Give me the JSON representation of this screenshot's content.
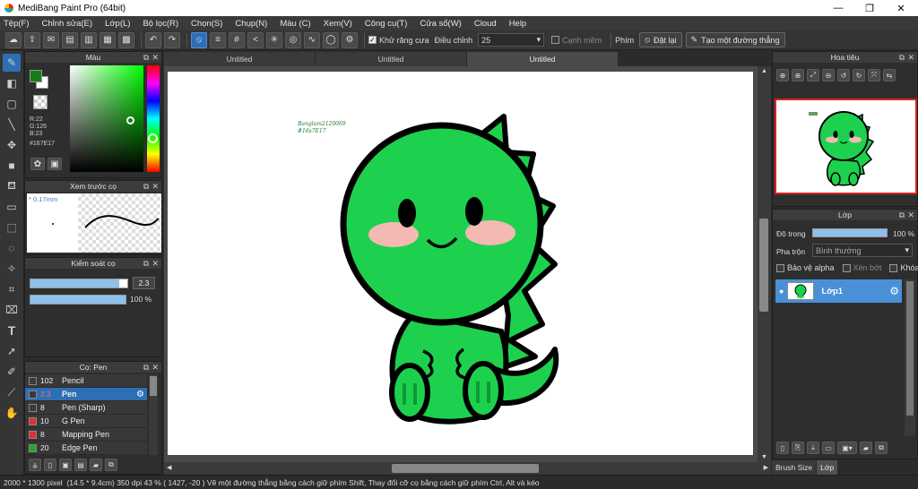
{
  "window": {
    "title": "MediBang Paint Pro (64bit)",
    "minimize": "—",
    "maximize": "❐",
    "close": "✕"
  },
  "menu": [
    "Tệp(F)",
    "Chỉnh sửa(E)",
    "Lớp(L)",
    "Bộ lọc(R)",
    "Chọn(S)",
    "Chụp(N)",
    "Màu (C)",
    "Xem(V)",
    "Công cụ(T)",
    "Cửa sổ(W)",
    "Cloud",
    "Help"
  ],
  "toolbar": {
    "antialias_label": "Khử răng cưa",
    "antialias_checked": true,
    "correction_label": "Điều chỉnh",
    "correction_value": "25",
    "edge_label": "Cạnh mềm",
    "edge_checked": false,
    "key_label": "Phím",
    "reset_label": "Đặt lại",
    "straight_line_label": "Tạo một đường thẳng"
  },
  "tools": [
    "brush-tool",
    "eraser-tool",
    "shape-tool",
    "line-tool",
    "move-tool",
    "fill-rect-tool",
    "bucket-tool",
    "gradient-tool",
    "select-tool",
    "lasso-tool",
    "magic-wand-tool",
    "select-pen-tool",
    "select-eraser-tool",
    "text-tool",
    "operation-tool",
    "eyedropper-tool",
    "divide-tool",
    "hand-tool"
  ],
  "color_panel": {
    "title": "Màu",
    "r": "R:22",
    "g": "G:126",
    "b": "B:23",
    "hex": "#167E17",
    "current_color": "#167E17"
  },
  "brush_preview": {
    "title": "Xem trước cọ",
    "size": "* 0.17mm"
  },
  "brush_control": {
    "title": "Kiểm soát cọ",
    "size_value": "2.3",
    "size_level": 0.92,
    "opacity_value": "100 %",
    "opacity_level": 1.0
  },
  "brush_list": {
    "title": "Cọ: Pen",
    "items": [
      {
        "size": "102",
        "name": "Pencil",
        "color": "#3a3a3a",
        "selected": false
      },
      {
        "size": "2.3",
        "name": "Pen",
        "color": "#3a3a3a",
        "selected": true
      },
      {
        "size": "8",
        "name": "Pen (Sharp)",
        "color": "#3a3a3a",
        "selected": false
      },
      {
        "size": "10",
        "name": "G Pen",
        "color": "#e03030",
        "selected": false
      },
      {
        "size": "8",
        "name": "Mapping Pen",
        "color": "#e03030",
        "selected": false
      },
      {
        "size": "20",
        "name": "Edge Pen",
        "color": "#22aa22",
        "selected": false
      }
    ]
  },
  "tabs": [
    "Untitled",
    "Untitled",
    "Untitled"
  ],
  "canvas": {
    "signature_line1": "Banglam2120069",
    "signature_line2": "#16s7E17"
  },
  "navigator": {
    "title": "Hoa tiêu"
  },
  "layer_panel": {
    "title": "Lớp",
    "opacity_label": "Độ trong",
    "opacity_value": "100 %",
    "opacity_level": 1.0,
    "blend_label": "Pha trộn",
    "blend_value": "Bình thường",
    "protect_alpha": "Bảo vệ alpha",
    "clipping": "Xén bớt",
    "lock": "Khóa",
    "layer_name": "Lớp1"
  },
  "bottom_tabs": [
    "Brush Size",
    "Lớp"
  ],
  "status": {
    "size": "2000 * 1300 pixel",
    "dims": "(14.5 * 9.4cm)",
    "dpi": "350 dpi",
    "zoom": "43 %",
    "coords": "( 1427, -20 )",
    "hint": "Vẽ một đường thẳng bằng cách giữ phím Shift, Thay đổi cỡ cọ bằng cách giữ phím Ctrl, Alt và kéo"
  }
}
